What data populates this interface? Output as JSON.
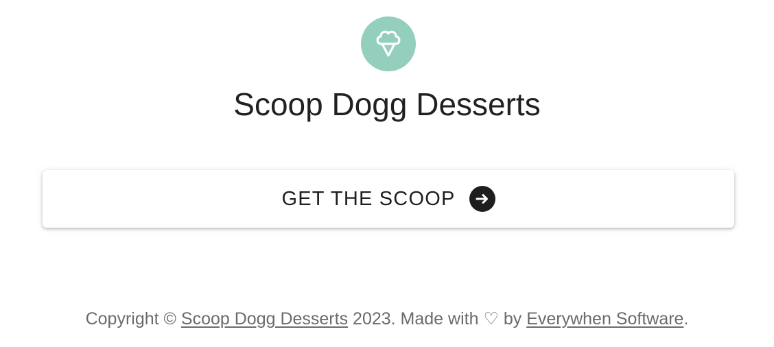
{
  "brand": {
    "name": "Scoop Dogg Desserts",
    "logo_icon": "ice-cream-icon",
    "logo_color": "#93cfbc"
  },
  "cta": {
    "label": "GET THE SCOOP",
    "icon": "arrow-right-circle-icon"
  },
  "footer": {
    "prefix": "Copyright ©",
    "brand_link": "Scoop Dogg Desserts",
    "middle": "2023. Made with",
    "heart": "♡",
    "by": "by",
    "company_link": "Everywhen Software",
    "suffix": "."
  }
}
